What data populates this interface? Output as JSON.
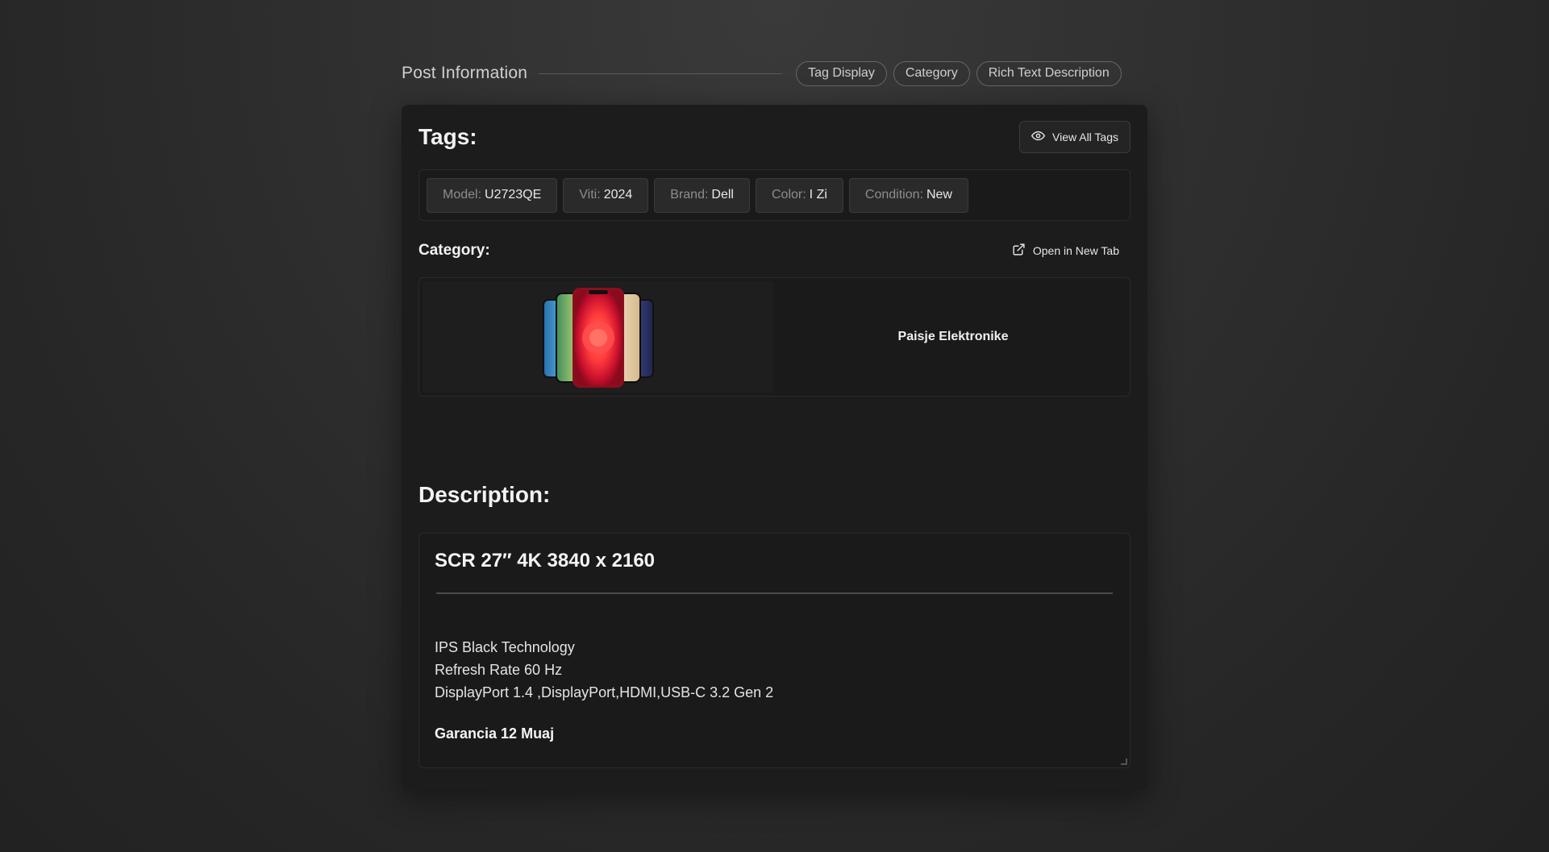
{
  "header": {
    "title": "Post Information",
    "pills": [
      "Tag Display",
      "Category",
      "Rich Text Description"
    ]
  },
  "tags_section": {
    "heading": "Tags:",
    "view_all_label": "View All Tags",
    "tags": [
      {
        "key": "Model:",
        "value": "U2723QE"
      },
      {
        "key": "Viti:",
        "value": "2024"
      },
      {
        "key": "Brand:",
        "value": "Dell"
      },
      {
        "key": "Color:",
        "value": "I Zi"
      },
      {
        "key": "Condition:",
        "value": "New"
      }
    ]
  },
  "category_section": {
    "heading": "Category:",
    "open_label": "Open in New Tab",
    "category_name": "Paisje Elektronike"
  },
  "description_section": {
    "heading": "Description:",
    "title": "SCR 27″ 4K 3840 x 2160",
    "lines": [
      "IPS Black Technology",
      "Refresh Rate 60 Hz",
      "DisplayPort 1.4 ,DisplayPort,HDMI,USB-C 3.2 Gen 2"
    ],
    "warranty": "Garancia 12 Muaj"
  },
  "colors": {
    "background": "#2b2b2b",
    "card": "#1c1c1c",
    "tag_bg": "#2a2a2a",
    "pill_border": "#666666"
  }
}
